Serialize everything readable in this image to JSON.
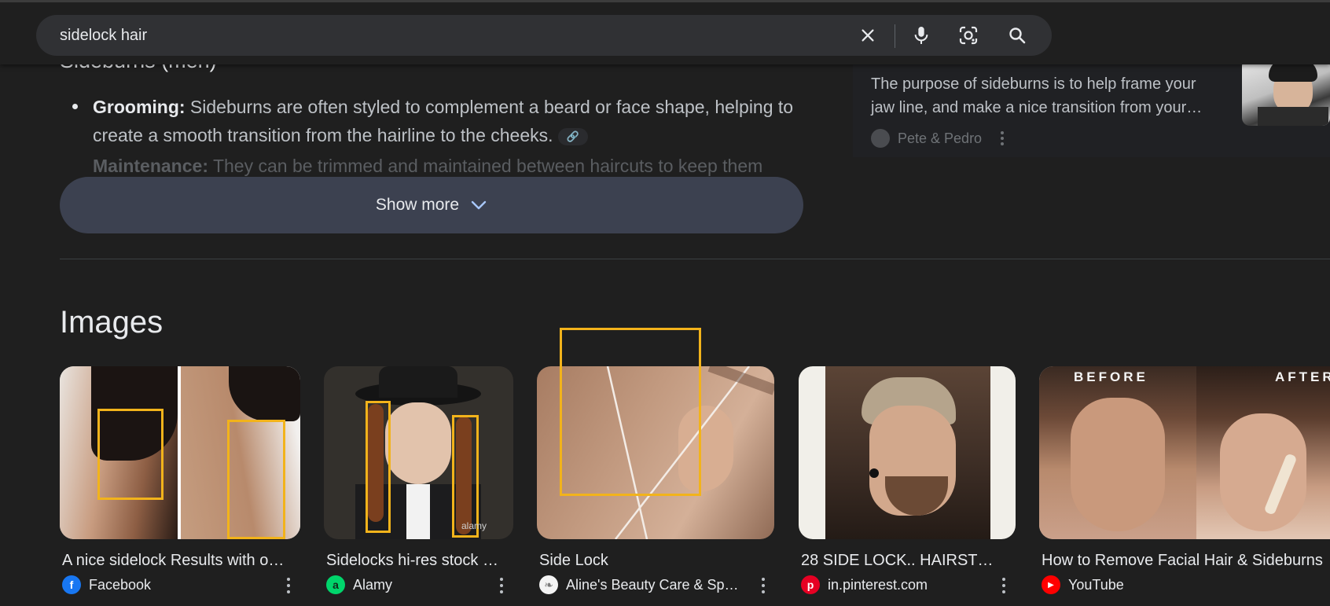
{
  "search": {
    "query": "sidelock hair"
  },
  "overview": {
    "section_title": "Sideburns (men)",
    "bullet_label": "Grooming:",
    "bullet_text": " Sideburns are often styled to complement a beard or face shape, helping to create a smooth transition from the hairline to the cheeks.",
    "faded_label": "Maintenance:",
    "faded_text": " They can be trimmed and maintained between haircuts to keep them",
    "show_more_label": "Show more"
  },
  "side_card": {
    "snippet": "The purpose of sideburns is to help frame your jaw line, and make a nice transition from your…",
    "source": "Pete & Pedro"
  },
  "images": {
    "title": "Images",
    "items": [
      {
        "caption": "A nice sidelock Results with o…",
        "source": "Facebook",
        "favicon": "facebook-icon",
        "color": "#1877f2",
        "glyph": "f"
      },
      {
        "caption": "Sidelocks hi-res stock …",
        "source": "Alamy",
        "favicon": "alamy-icon",
        "color": "#00d56b",
        "glyph": "a"
      },
      {
        "caption": "Side Lock",
        "source": "Aline's Beauty Care & Sp…",
        "favicon": "leaf-icon",
        "color": "#ffffff",
        "glyph": ""
      },
      {
        "caption": "28 SIDE LOCK.. HAIRST…",
        "source": "in.pinterest.com",
        "favicon": "pinterest-icon",
        "color": "#e60023",
        "glyph": "p"
      },
      {
        "caption": "How to Remove Facial Hair & Sideburns",
        "source": "YouTube",
        "favicon": "youtube-icon",
        "color": "#ff0000",
        "glyph": "▶"
      }
    ],
    "overlay_text": {
      "before": "BEFORE",
      "after": "AFTER",
      "watermark": "alamy"
    }
  },
  "colors": {
    "background": "#1f1f1f",
    "button": "#3c4150",
    "highlight_box": "#f2b31b"
  }
}
